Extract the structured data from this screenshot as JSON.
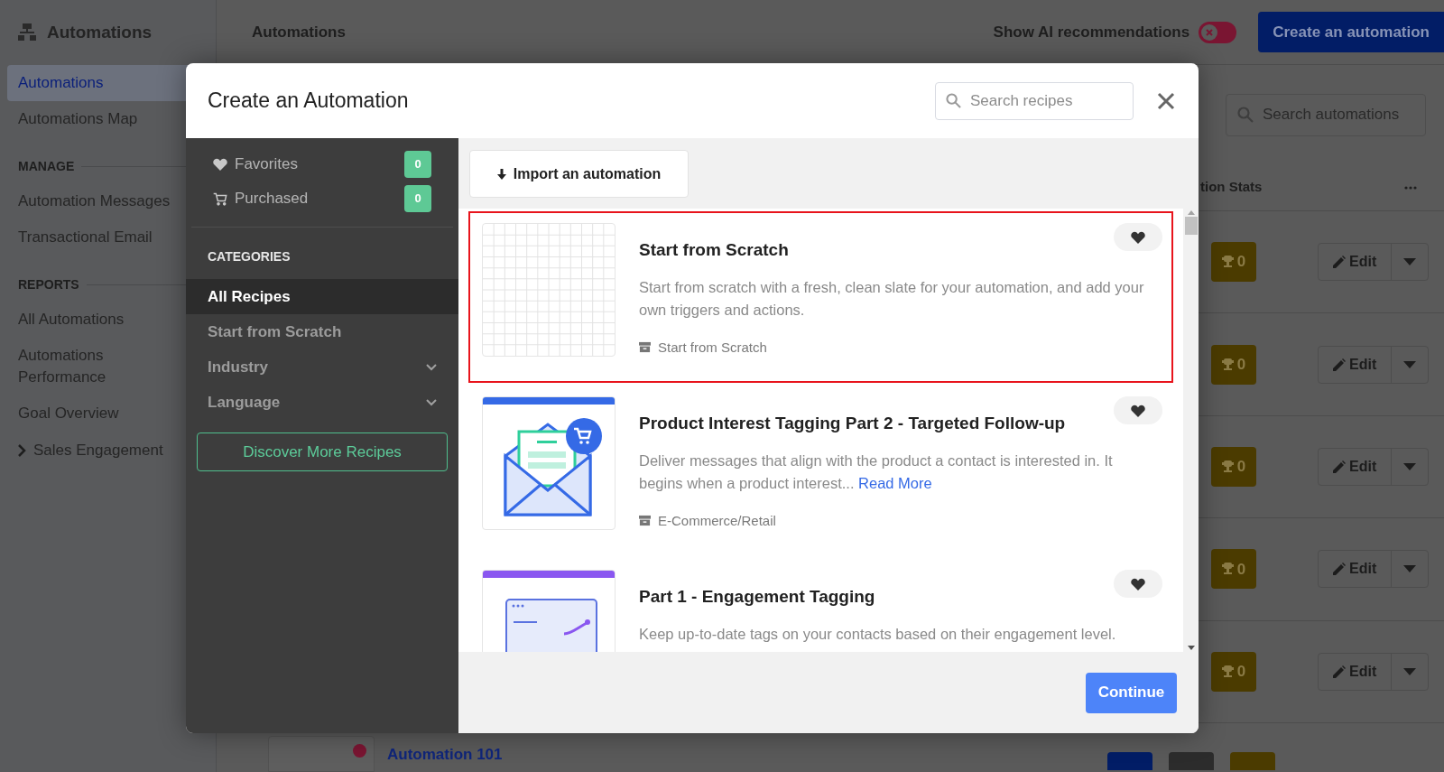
{
  "sidebar": {
    "title": "Automations",
    "nav": [
      {
        "kind": "link",
        "label": "Automations",
        "selected": true
      },
      {
        "kind": "link",
        "label": "Automations Map",
        "selected": false
      },
      {
        "kind": "heading",
        "label": "MANAGE"
      },
      {
        "kind": "link",
        "label": "Automation Messages",
        "selected": false
      },
      {
        "kind": "link",
        "label": "Transactional Email",
        "selected": false
      },
      {
        "kind": "heading",
        "label": "REPORTS"
      },
      {
        "kind": "link",
        "label": "All Automations",
        "selected": false
      },
      {
        "kind": "link",
        "label": "Automations Performance",
        "selected": false
      },
      {
        "kind": "link",
        "label": "Goal Overview",
        "selected": false
      },
      {
        "kind": "group",
        "label": "Sales Engagement",
        "expanded": false
      }
    ]
  },
  "header": {
    "title": "Automations",
    "ai_toggle": {
      "label": "Show AI recommendations",
      "on": false
    },
    "create_button": "Create an automation"
  },
  "toolbar": {
    "search": {
      "placeholder": "Search automations"
    }
  },
  "table": {
    "column_header": "tion Stats",
    "rows": [
      {
        "goals": "0",
        "edit": "Edit"
      },
      {
        "goals": "0",
        "edit": "Edit"
      },
      {
        "goals": "0",
        "edit": "Edit"
      },
      {
        "goals": "0",
        "edit": "Edit"
      },
      {
        "goals": "0",
        "edit": "Edit"
      }
    ],
    "partial_row": {
      "name": "Automation 101"
    }
  },
  "modal": {
    "title": "Create an Automation",
    "search": {
      "placeholder": "Search recipes"
    },
    "filters": [
      {
        "kind": "favorites",
        "label": "Favorites",
        "count": "0"
      },
      {
        "kind": "purchased",
        "label": "Purchased",
        "count": "0"
      }
    ],
    "categories_heading": "CATEGORIES",
    "categories": [
      {
        "label": "All Recipes",
        "selected": true,
        "expandable": false
      },
      {
        "label": "Start from Scratch",
        "selected": false,
        "expandable": false
      },
      {
        "label": "Industry",
        "selected": false,
        "expandable": true
      },
      {
        "label": "Language",
        "selected": false,
        "expandable": true
      }
    ],
    "discover_button": "Discover More Recipes",
    "import_button": "Import an automation",
    "recipes": [
      {
        "kind": "grid",
        "title": "Start from Scratch",
        "description": "Start from scratch with a fresh, clean slate for your automation, and add your own triggers and actions.",
        "category": "Start from Scratch",
        "highlighted": true
      },
      {
        "kind": "envelope",
        "title": "Product Interest Tagging Part 2 - Targeted Follow-up",
        "description": "Deliver messages that align with the product a contact is interested in. It begins when a product interest...",
        "read_more": "Read More",
        "category": "E-Commerce/Retail",
        "highlighted": false
      },
      {
        "kind": "chart",
        "title": "Part 1 - Engagement Tagging",
        "description": "Keep up-to-date tags on your contacts based on their engagement level.",
        "highlighted": false
      }
    ],
    "continue_button": "Continue"
  }
}
